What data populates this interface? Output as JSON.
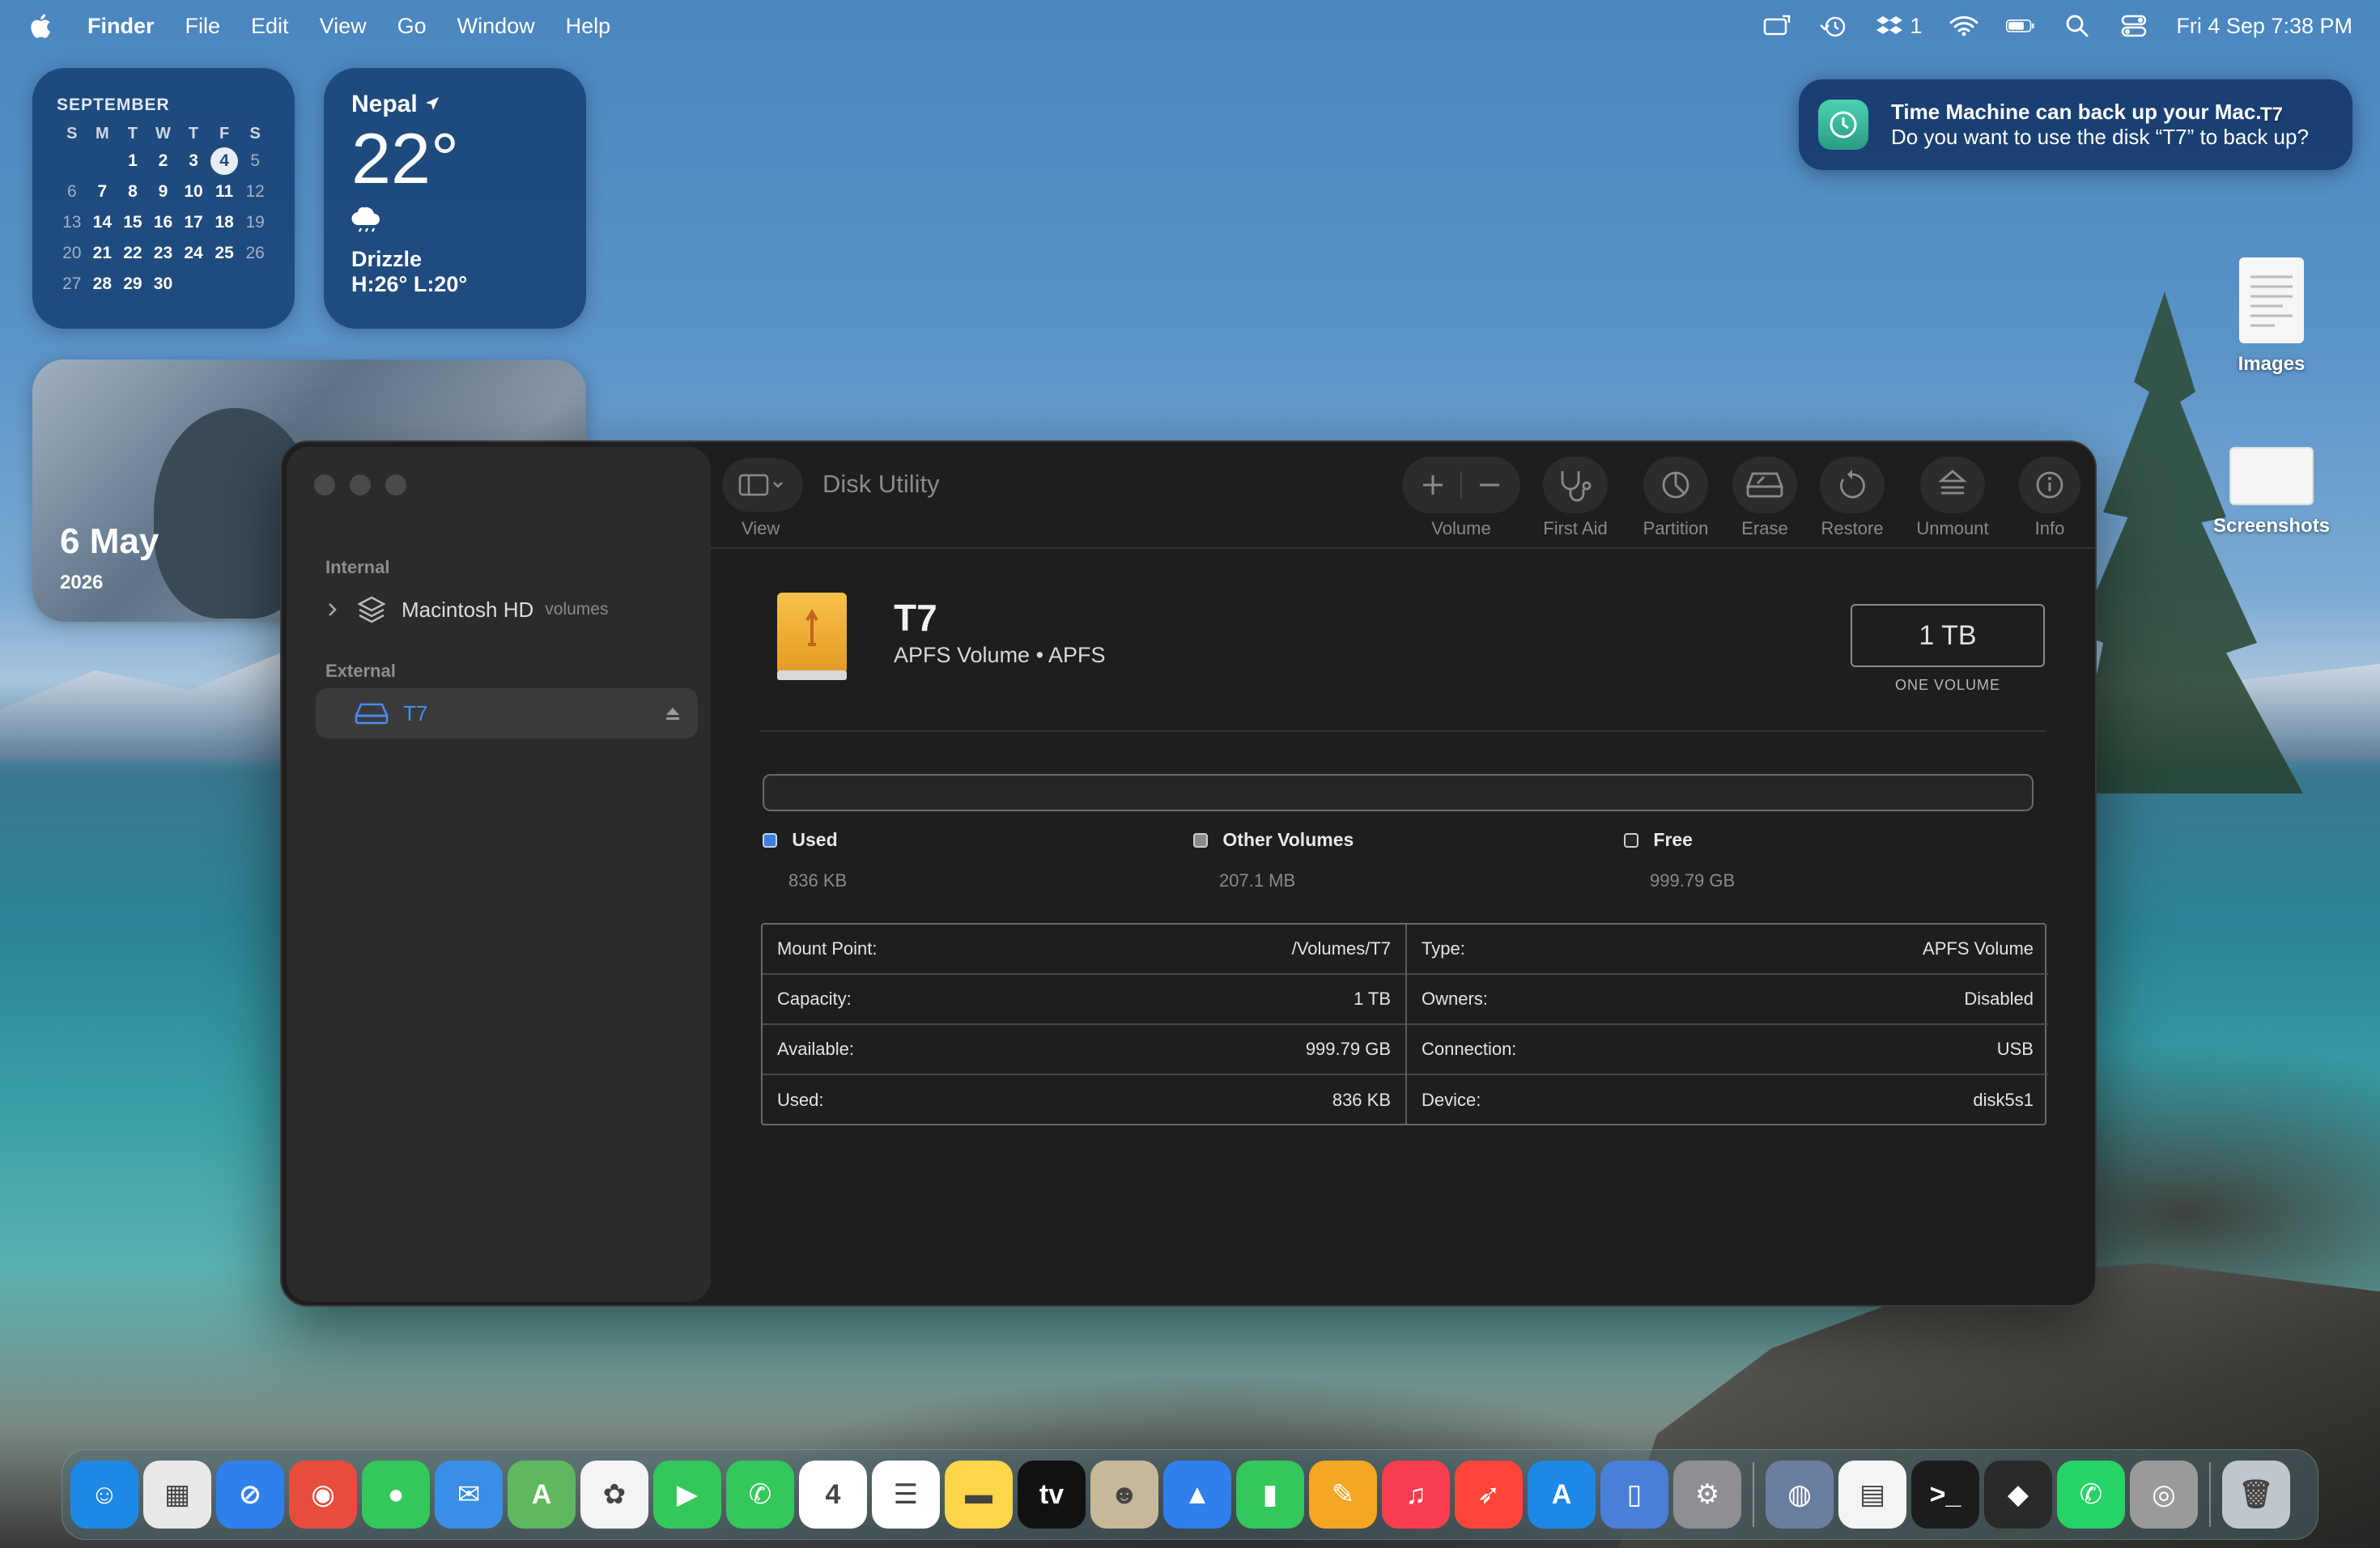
{
  "menubar": {
    "app_name": "Finder",
    "items": [
      "File",
      "Edit",
      "View",
      "Go",
      "Window",
      "Help"
    ],
    "status_badge_count": "1",
    "datetime": "Fri 4 Sep  7:38 PM"
  },
  "calendar_widget": {
    "month": "SEPTEMBER",
    "weekdays": [
      "S",
      "M",
      "T",
      "W",
      "T",
      "F",
      "S"
    ],
    "weeks": [
      [
        "",
        "",
        "1",
        "2",
        "3",
        "4",
        "5"
      ],
      [
        "6",
        "7",
        "8",
        "9",
        "10",
        "11",
        "12"
      ],
      [
        "13",
        "14",
        "15",
        "16",
        "17",
        "18",
        "19"
      ],
      [
        "20",
        "21",
        "22",
        "23",
        "24",
        "25",
        "26"
      ],
      [
        "27",
        "28",
        "29",
        "30",
        "",
        "",
        ""
      ]
    ],
    "today": "4"
  },
  "weather_widget": {
    "location": "Nepal",
    "temperature": "22°",
    "condition": "Drizzle",
    "high_low": "H:26° L:20°"
  },
  "photo_widget": {
    "date": "6 May",
    "year": "2026"
  },
  "notification": {
    "title": "Time Machine can back up your Mac.",
    "body": "Do you want to use the disk “T7” to back up?"
  },
  "desktop_items": [
    {
      "label": "T7"
    },
    {
      "label": "Images"
    },
    {
      "label": "Screenshots"
    }
  ],
  "window": {
    "title": "Disk Utility",
    "view_label": "View",
    "toolbar": {
      "volume": "Volume",
      "first_aid": "First Aid",
      "partition": "Partition",
      "erase": "Erase",
      "restore": "Restore",
      "unmount": "Unmount",
      "info": "Info"
    },
    "sidebar": {
      "internal_header": "Internal",
      "internal_disk": "Macintosh HD",
      "internal_disk_sub": "volumes",
      "external_header": "External",
      "external_disk": "T7"
    },
    "volume": {
      "name": "T7",
      "subtitle": "APFS Volume • APFS",
      "size": "1 TB",
      "size_caption": "ONE VOLUME"
    },
    "usage": {
      "used_fraction": 8e-07,
      "used_label": "Used",
      "used_value": "836 KB",
      "other_label": "Other Volumes",
      "other_value": "207.1 MB",
      "free_label": "Free",
      "free_value": "999.79 GB",
      "colors": {
        "used": "#3d7fe0",
        "other": "#8a8a8a",
        "free": "#262626"
      }
    },
    "info": {
      "left": [
        {
          "key": "Mount Point:",
          "value": "/Volumes/T7"
        },
        {
          "key": "Capacity:",
          "value": "1 TB"
        },
        {
          "key": "Available:",
          "value": "999.79 GB"
        },
        {
          "key": "Used:",
          "value": "836 KB"
        }
      ],
      "right": [
        {
          "key": "Type:",
          "value": "APFS Volume"
        },
        {
          "key": "Owners:",
          "value": "Disabled"
        },
        {
          "key": "Connection:",
          "value": "USB"
        },
        {
          "key": "Device:",
          "value": "disk5s1"
        }
      ]
    }
  },
  "dock": {
    "apps": [
      {
        "name": "finder-icon",
        "color": "#1e88e5",
        "glyph": "☺"
      },
      {
        "name": "launchpad-icon",
        "color": "#e8e8e8",
        "glyph": "▦"
      },
      {
        "name": "safari-icon",
        "color": "#2f80ed",
        "glyph": "⊘"
      },
      {
        "name": "chrome-icon",
        "color": "#e74c3c",
        "glyph": "◉"
      },
      {
        "name": "messages-icon",
        "color": "#34c759",
        "glyph": "●"
      },
      {
        "name": "mail-icon",
        "color": "#3a8ee6",
        "glyph": "✉"
      },
      {
        "name": "maps-icon",
        "color": "#5fb85f",
        "glyph": "A"
      },
      {
        "name": "photos-icon",
        "color": "#f4f4f4",
        "glyph": "✿"
      },
      {
        "name": "facetime-icon",
        "color": "#34c759",
        "glyph": "▶"
      },
      {
        "name": "phone-icon",
        "color": "#34c759",
        "glyph": "✆"
      },
      {
        "name": "calendar-icon",
        "color": "#ffffff",
        "glyph": "4"
      },
      {
        "name": "reminders-icon",
        "color": "#ffffff",
        "glyph": "☰"
      },
      {
        "name": "notes-icon",
        "color": "#ffd54a",
        "glyph": "▬"
      },
      {
        "name": "tv-icon",
        "color": "#111111",
        "glyph": "tv"
      },
      {
        "name": "contacts-icon",
        "color": "#c8b89a",
        "glyph": "☻"
      },
      {
        "name": "keynote-icon",
        "color": "#2f80ed",
        "glyph": "▲"
      },
      {
        "name": "numbers-icon",
        "color": "#34c759",
        "glyph": "▮"
      },
      {
        "name": "pages-icon",
        "color": "#f5a623",
        "glyph": "✎"
      },
      {
        "name": "music-icon",
        "color": "#fa3c50",
        "glyph": "♫"
      },
      {
        "name": "rocket-icon",
        "color": "#ff453a",
        "glyph": "➶"
      },
      {
        "name": "app-store-icon",
        "color": "#1e88e5",
        "glyph": "A"
      },
      {
        "name": "simulator-icon",
        "color": "#4a7fd8",
        "glyph": "▯"
      },
      {
        "name": "system-settings-icon",
        "color": "#8e8e93",
        "glyph": "⚙"
      },
      {
        "name": "disk-utility-icon",
        "color": "#6a7fa0",
        "glyph": "◍"
      },
      {
        "name": "text-document-icon",
        "color": "#f4f4f4",
        "glyph": "▤"
      },
      {
        "name": "terminal-icon",
        "color": "#1c1c1c",
        "glyph": ">_"
      },
      {
        "name": "cube-app-icon",
        "color": "#2a2a2a",
        "glyph": "◆"
      },
      {
        "name": "whatsapp-icon",
        "color": "#25d366",
        "glyph": "✆"
      },
      {
        "name": "utility-app-icon",
        "color": "#9a9a9a",
        "glyph": "◎"
      },
      {
        "name": "trash-icon",
        "color": "#bfc6cc",
        "glyph": "🗑"
      }
    ]
  }
}
